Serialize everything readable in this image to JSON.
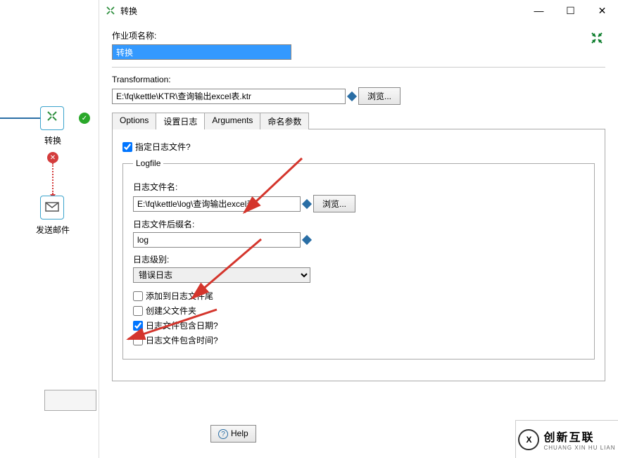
{
  "canvas": {
    "prev_hop_color": "#2a6ea5",
    "success_icon_name": "check-icon",
    "error_icon_name": "x-icon",
    "step1": {
      "label": "转换",
      "icon": "transform"
    },
    "step2": {
      "label": "发送邮件",
      "icon": "envelope"
    }
  },
  "dialog": {
    "title": "转换",
    "collapse": "collapse",
    "job_entry_name_label": "作业项名称:",
    "job_entry_name_value": "转换",
    "transformation_label": "Transformation:",
    "transformation_value": "E:\\fq\\kettle\\KTR\\查询输出excel表.ktr",
    "browse_label": "浏览...",
    "tabs": {
      "options": "Options",
      "setlog": "设置日志",
      "arguments": "Arguments",
      "namedparams": "命名参数"
    },
    "specify_logfile_label": "指定日志文件?",
    "specify_logfile_checked": true,
    "legend": "Logfile",
    "logfile_name_label": "日志文件名:",
    "logfile_name_value": "E:\\fq\\kettle\\log\\查询输出excel表",
    "logfile_ext_label": "日志文件后缀名:",
    "logfile_ext_value": "log",
    "log_level_label": "日志级别:",
    "log_level_value": "错误日志",
    "append_logfile_label": "添加到日志文件尾",
    "append_logfile_checked": false,
    "create_parent_folder_label": "创建父文件夹",
    "create_parent_folder_checked": false,
    "include_date_label": "日志文件包含日期?",
    "include_date_checked": true,
    "include_time_label": "日志文件包含时间?",
    "include_time_checked": false,
    "help_label": "Help"
  },
  "watermark": {
    "brand": "创新互联",
    "sub": "CHUANG XIN HU LIAN",
    "logo": "X"
  },
  "win": {
    "min": "—",
    "max": "☐",
    "close": "✕"
  }
}
